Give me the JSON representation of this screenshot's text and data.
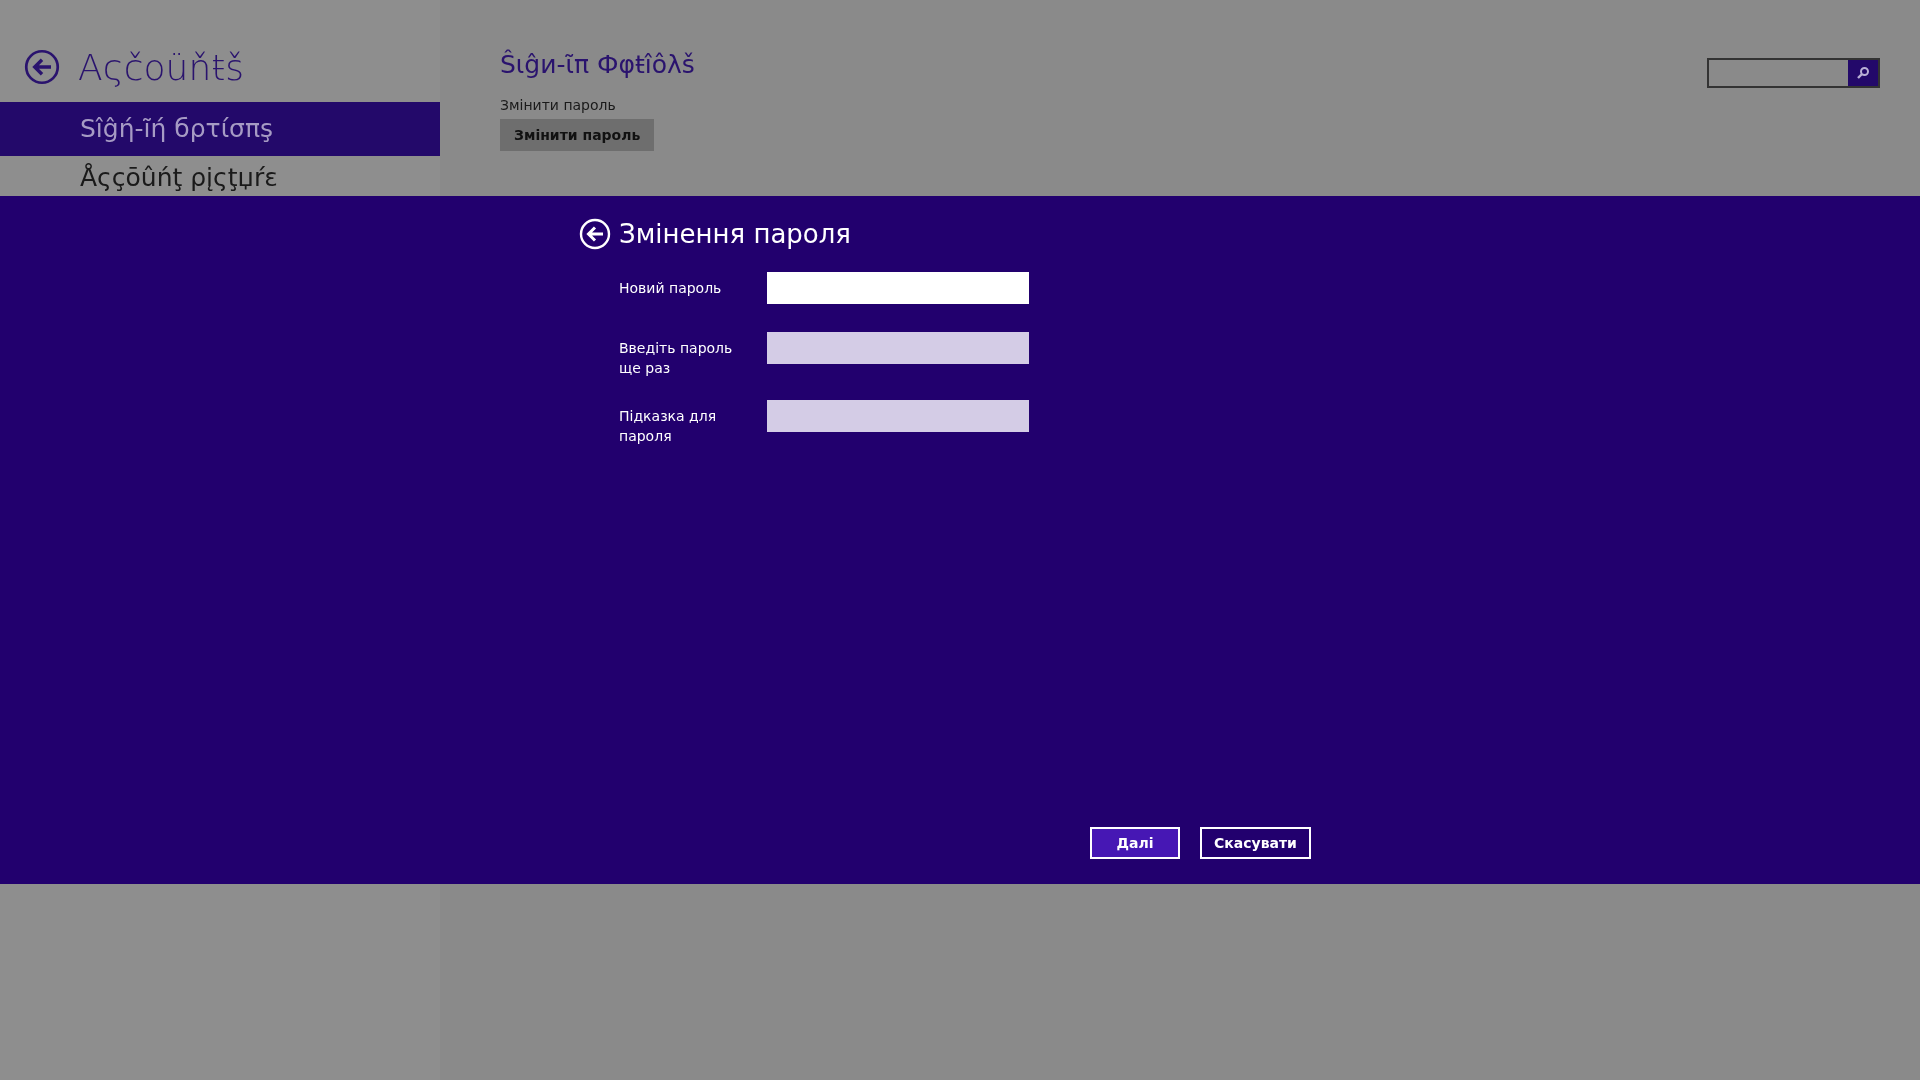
{
  "page": {
    "back_title": "Aςčoüňŧš",
    "sidebar_items": [
      {
        "label": "Sîĝή-ĩή бρτίσπş",
        "selected": true
      },
      {
        "label": "Åςçōûńţ ρįςţџŕε",
        "selected": false
      }
    ],
    "section_title": "Ŝιĝи-ῖπ Фφŧîôλš",
    "change_password_label": "Змінити пароль",
    "change_password_button": "Змінити пароль"
  },
  "dialog": {
    "title": "Змінення пароля",
    "fields": [
      {
        "label": "Новий пароль",
        "focused": true
      },
      {
        "label": "Введіть пароль ще раз",
        "focused": false
      },
      {
        "label": "Підказка для пароля",
        "focused": false
      }
    ],
    "buttons": [
      {
        "label": "Далі",
        "kind": "primary"
      },
      {
        "label": "Скасувати",
        "kind": "secondary"
      }
    ]
  }
}
